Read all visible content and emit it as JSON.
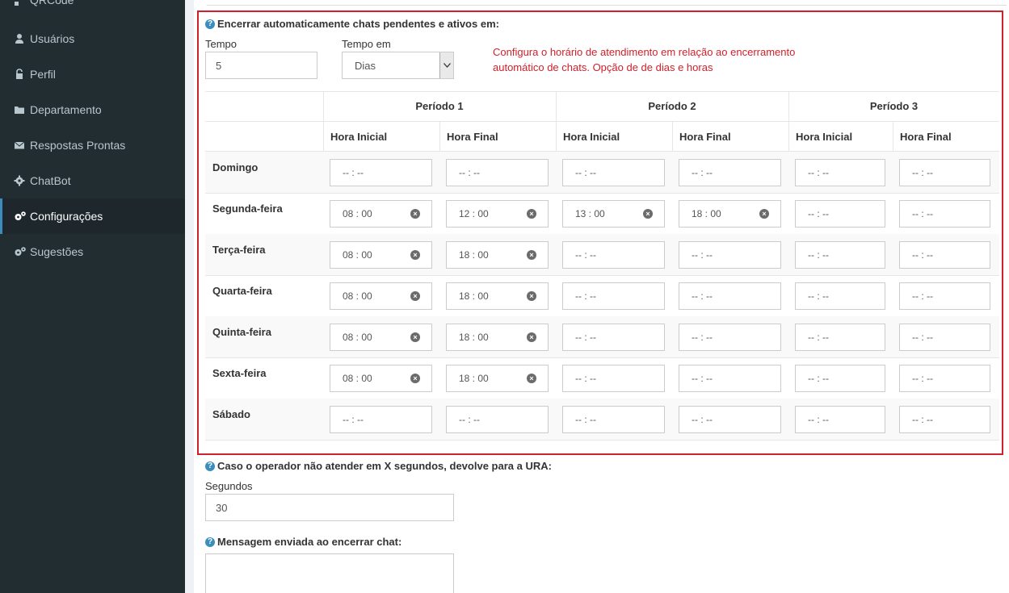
{
  "sidebar": {
    "items": [
      {
        "label": "QRCode",
        "icon": "qrcode-icon"
      },
      {
        "label": "Usuários",
        "icon": "user-icon"
      },
      {
        "label": "Perfil",
        "icon": "lock-icon"
      },
      {
        "label": "Departamento",
        "icon": "folder-icon"
      },
      {
        "label": "Respostas Prontas",
        "icon": "envelope-icon"
      },
      {
        "label": "ChatBot",
        "icon": "gear-icon"
      },
      {
        "label": "Configurações",
        "icon": "gears-icon",
        "active": true
      },
      {
        "label": "Sugestões",
        "icon": "gears-icon"
      }
    ]
  },
  "auto_close": {
    "title": "Encerrar automaticamente chats pendentes e ativos em:",
    "tempo_label": "Tempo",
    "tempo_value": "5",
    "tempo_em_label": "Tempo em",
    "tempo_em_value": "Dias",
    "note": "Configura o horário de atendimento em relação ao encerramento automático de chats. Opção de de dias e horas"
  },
  "schedule": {
    "periods": [
      "Período 1",
      "Período 2",
      "Período 3"
    ],
    "sub_headers": [
      "Hora Inicial",
      "Hora Final",
      "Hora Inicial",
      "Hora Final",
      "Hora Inicial",
      "Hora Final"
    ],
    "empty_value": "-- : --",
    "days": [
      {
        "name": "Domingo",
        "times": [
          "",
          "",
          "",
          "",
          "",
          ""
        ]
      },
      {
        "name": "Segunda-feira",
        "times": [
          "08 : 00",
          "12 : 00",
          "13 : 00",
          "18 : 00",
          "",
          ""
        ]
      },
      {
        "name": "Terça-feira",
        "times": [
          "08 : 00",
          "18 : 00",
          "",
          "",
          "",
          ""
        ]
      },
      {
        "name": "Quarta-feira",
        "times": [
          "08 : 00",
          "18 : 00",
          "",
          "",
          "",
          ""
        ]
      },
      {
        "name": "Quinta-feira",
        "times": [
          "08 : 00",
          "18 : 00",
          "",
          "",
          "",
          ""
        ]
      },
      {
        "name": "Sexta-feira",
        "times": [
          "08 : 00",
          "18 : 00",
          "",
          "",
          "",
          ""
        ]
      },
      {
        "name": "Sábado",
        "times": [
          "",
          "",
          "",
          "",
          "",
          ""
        ]
      }
    ]
  },
  "ura": {
    "title": "Caso o operador não atender em X segundos, devolve para a URA:",
    "segundos_label": "Segundos",
    "segundos_value": "30"
  },
  "close_message": {
    "title": "Mensagem enviada ao encerrar chat:",
    "value": ""
  },
  "colors": {
    "sidebar_bg": "#222d32",
    "accent": "#3c8dbc",
    "highlight_border": "#d0202b"
  }
}
